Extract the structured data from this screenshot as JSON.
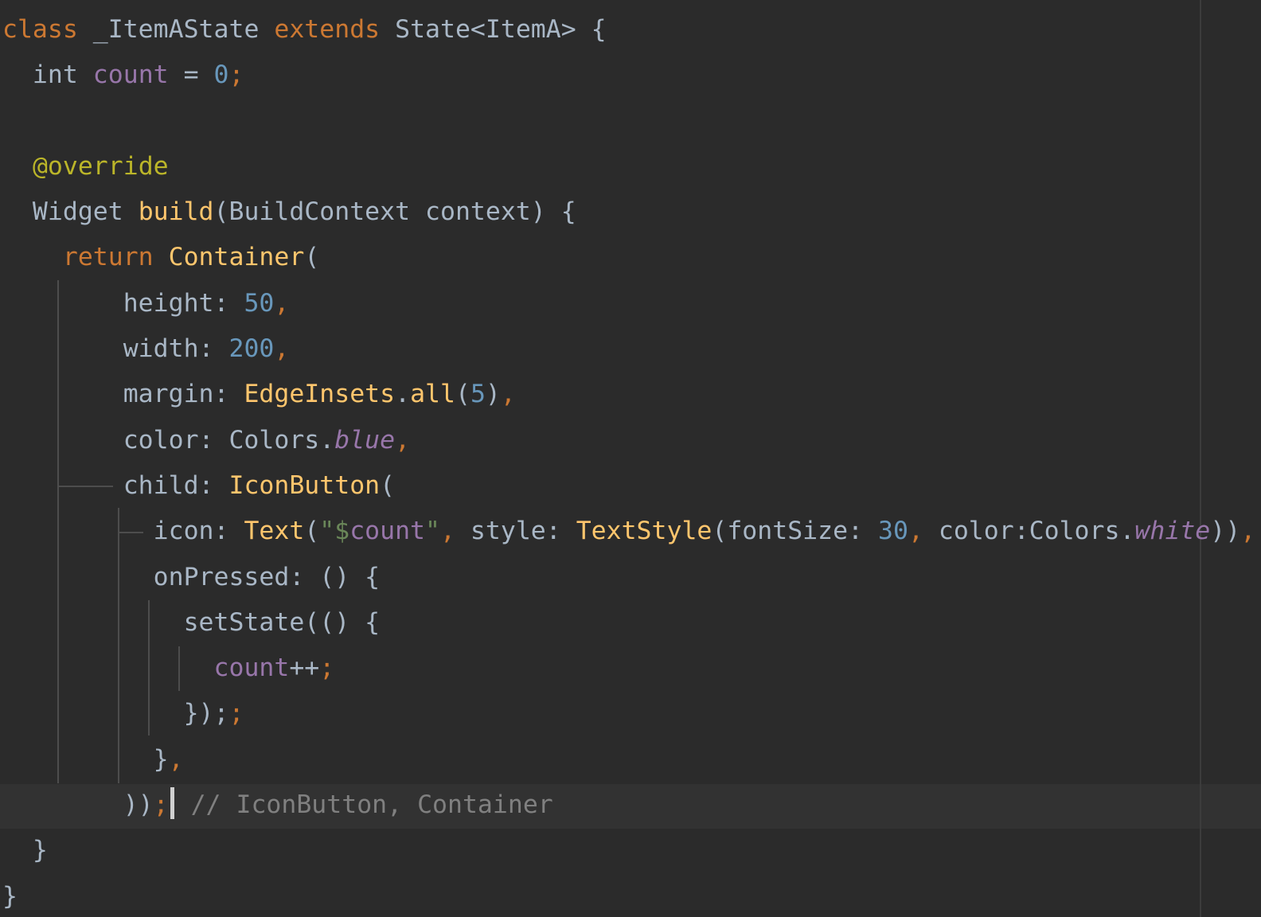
{
  "editor": {
    "lines": [
      [
        {
          "t": "class",
          "c": "kw"
        },
        {
          "t": " _ItemAState "
        },
        {
          "t": "extends",
          "c": "kw"
        },
        {
          "t": " State<ItemA> {"
        }
      ],
      [
        {
          "t": "  int "
        },
        {
          "t": "count",
          "c": "field"
        },
        {
          "t": " = "
        },
        {
          "t": "0",
          "c": "num"
        },
        {
          "t": ";",
          "c": "kw"
        }
      ],
      [],
      [
        {
          "t": "  "
        },
        {
          "t": "@override",
          "c": "ann"
        }
      ],
      [
        {
          "t": "  Widget "
        },
        {
          "t": "build",
          "c": "fn"
        },
        {
          "t": "(BuildContext context) {"
        }
      ],
      [
        {
          "t": "    "
        },
        {
          "t": "return",
          "c": "kw"
        },
        {
          "t": " "
        },
        {
          "t": "Container",
          "c": "fn"
        },
        {
          "t": "("
        }
      ],
      [
        {
          "t": "        height: "
        },
        {
          "t": "50",
          "c": "num"
        },
        {
          "t": ",",
          "c": "kw"
        }
      ],
      [
        {
          "t": "        width: "
        },
        {
          "t": "200",
          "c": "num"
        },
        {
          "t": ",",
          "c": "kw"
        }
      ],
      [
        {
          "t": "        margin: "
        },
        {
          "t": "EdgeInsets",
          "c": "fn"
        },
        {
          "t": "."
        },
        {
          "t": "all",
          "c": "fn"
        },
        {
          "t": "("
        },
        {
          "t": "5",
          "c": "num"
        },
        {
          "t": ")"
        },
        {
          "t": ",",
          "c": "kw"
        }
      ],
      [
        {
          "t": "        color: Colors."
        },
        {
          "t": "blue",
          "c": "fieldi"
        },
        {
          "t": ",",
          "c": "kw"
        }
      ],
      [
        {
          "t": "        child: "
        },
        {
          "t": "IconButton",
          "c": "fn"
        },
        {
          "t": "("
        }
      ],
      [
        {
          "t": "          icon: "
        },
        {
          "t": "Text",
          "c": "fn"
        },
        {
          "t": "("
        },
        {
          "t": "\"",
          "c": "str"
        },
        {
          "t": "$",
          "c": "str"
        },
        {
          "t": "count",
          "c": "field"
        },
        {
          "t": "\"",
          "c": "str"
        },
        {
          "t": ",",
          "c": "kw"
        },
        {
          "t": " style: "
        },
        {
          "t": "TextStyle",
          "c": "fn"
        },
        {
          "t": "(fontSize: "
        },
        {
          "t": "30",
          "c": "num"
        },
        {
          "t": ",",
          "c": "kw"
        },
        {
          "t": " color:Colors."
        },
        {
          "t": "white",
          "c": "fieldi"
        },
        {
          "t": "))"
        },
        {
          "t": ",",
          "c": "kw"
        }
      ],
      [
        {
          "t": "          onPressed: () {"
        }
      ],
      [
        {
          "t": "            setState(() {"
        }
      ],
      [
        {
          "t": "              "
        },
        {
          "t": "count",
          "c": "field"
        },
        {
          "t": "++"
        },
        {
          "t": ";",
          "c": "kw"
        }
      ],
      [
        {
          "t": "            });"
        },
        {
          "t": ";",
          "c": "kw"
        }
      ],
      [
        {
          "t": "          }"
        },
        {
          "t": ",",
          "c": "kw"
        }
      ],
      [
        {
          "t": "        ))"
        },
        {
          "t": ";",
          "c": "kw"
        },
        {
          "caret": true
        },
        {
          "t": " "
        },
        {
          "t": "// IconButton, Container",
          "c": "cmt"
        }
      ],
      [
        {
          "t": "  }"
        }
      ],
      [
        {
          "t": "}"
        }
      ]
    ]
  }
}
